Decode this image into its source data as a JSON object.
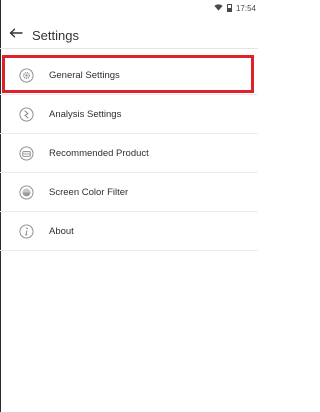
{
  "status_bar": {
    "time": "17:54",
    "wifi_icon": "wifi-icon",
    "battery_icon": "battery-icon"
  },
  "app_bar": {
    "back_icon": "arrow-left-icon",
    "title": "Settings"
  },
  "menu": {
    "items": [
      {
        "label": "General Settings",
        "icon": "gear-icon"
      },
      {
        "label": "Analysis Settings",
        "icon": "analysis-icon"
      },
      {
        "label": "Recommended Product",
        "icon": "product-icon"
      },
      {
        "label": "Screen Color Filter",
        "icon": "color-filter-icon"
      },
      {
        "label": "About",
        "icon": "info-icon"
      }
    ]
  },
  "colors": {
    "highlight": "#e0202a",
    "icon_gray": "#8a8a8a",
    "divider": "#ececec"
  }
}
